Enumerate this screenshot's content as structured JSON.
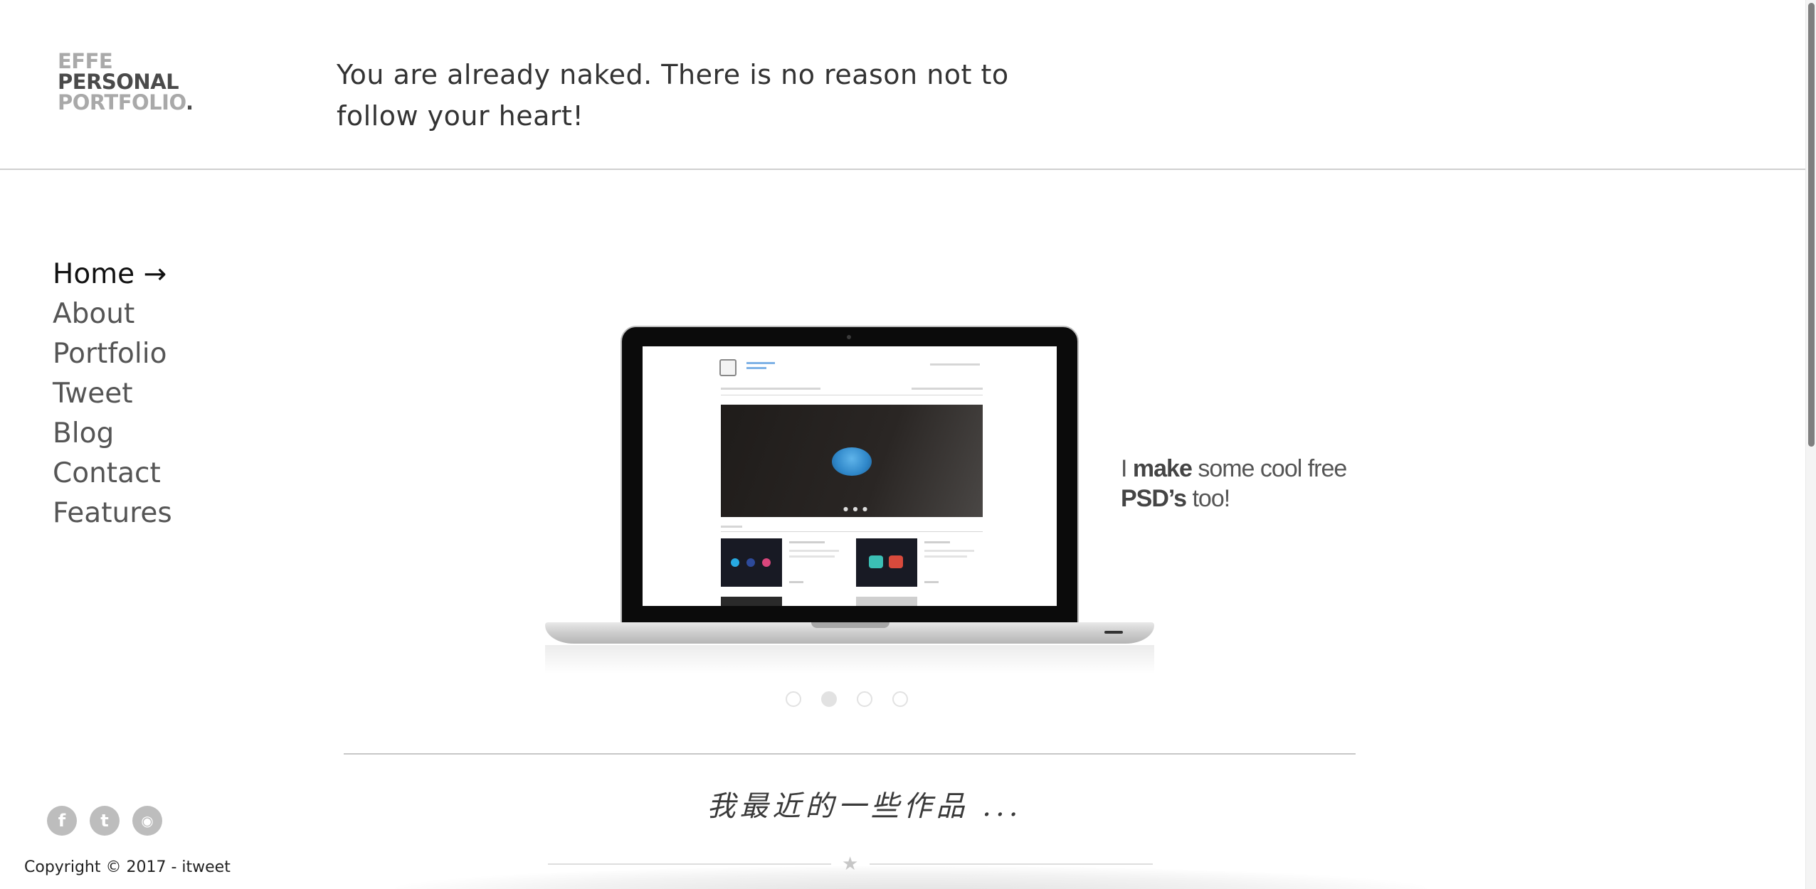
{
  "logo": {
    "line1": "EFFE",
    "line2": "PERSONAL",
    "line3": "PORTFOLIO",
    "dot": "."
  },
  "header": {
    "tagline": "You are already naked. There is no reason not to follow your heart!"
  },
  "nav": {
    "items": [
      {
        "label": "Home →",
        "active": true
      },
      {
        "label": "About",
        "active": false
      },
      {
        "label": "Portfolio",
        "active": false
      },
      {
        "label": "Tweet",
        "active": false
      },
      {
        "label": "Blog",
        "active": false
      },
      {
        "label": "Contact",
        "active": false
      },
      {
        "label": "Features",
        "active": false
      }
    ]
  },
  "slider": {
    "caption": {
      "part1": "I ",
      "bold1": "make",
      "part2": " some cool free ",
      "bold2": "PSD’s",
      "part3": " too!"
    },
    "dot_count": 4,
    "active_dot": 2
  },
  "works": {
    "heading": "我最近的一些作品 ..."
  },
  "social": {
    "icons": [
      "facebook-icon",
      "twitter-icon",
      "rss-icon"
    ],
    "glyphs": [
      "f",
      "t",
      "◉"
    ]
  },
  "footer": {
    "copyright": "Copyright © 2017 - itweet"
  },
  "colors": {
    "text": "#333333",
    "muted": "#a9a9a9",
    "rule": "#cfcfcf",
    "icon_bg": "#bdbdbd"
  }
}
